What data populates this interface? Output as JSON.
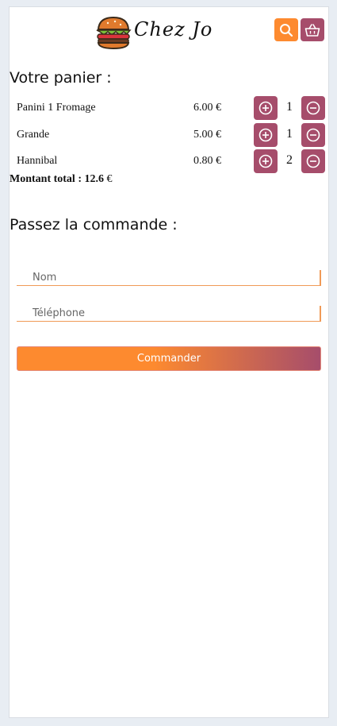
{
  "header": {
    "brand": "Chez Jo",
    "search_icon": "search-icon",
    "cart_icon": "basket-icon"
  },
  "cart": {
    "title": "Votre panier :",
    "items": [
      {
        "name": "Panini 1 Fromage",
        "price": "6.00 €",
        "qty": "1"
      },
      {
        "name": "Grande",
        "price": "5.00 €",
        "qty": "1"
      },
      {
        "name": "Hannibal",
        "price": "0.80 €",
        "qty": "2"
      }
    ],
    "total_label": "Montant total : 12.6",
    "total_currency": " €"
  },
  "order": {
    "title": "Passez la commande :",
    "name_placeholder": "Nom",
    "phone_placeholder": "Téléphone",
    "submit_label": "Commander"
  },
  "colors": {
    "accent_orange": "#fd8a2f",
    "accent_plum": "#a64d6b"
  }
}
